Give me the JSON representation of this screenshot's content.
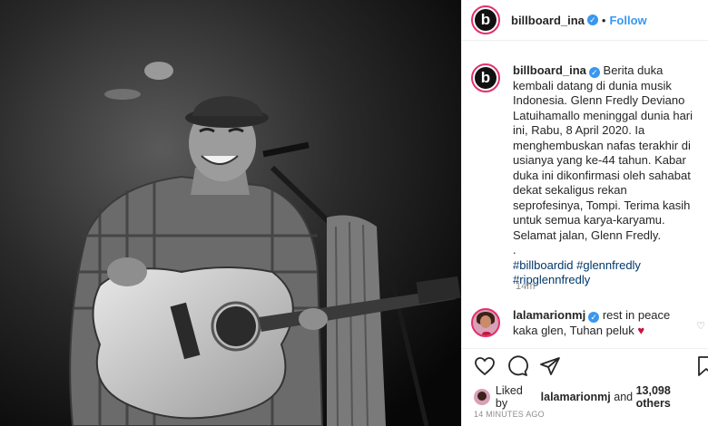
{
  "header": {
    "username": "billboard_ina",
    "avatar_letter": "b",
    "follow_label": "Follow",
    "separator": "•"
  },
  "caption": {
    "username": "billboard_ina",
    "text": "Berita duka kembali datang di dunia musik Indonesia. Glenn Fredly Deviano Latuihamallo meninggal dunia hari ini, Rabu, 8 April 2020. Ia menghembuskan nafas terakhir di usianya yang ke-44 tahun. Kabar duka ini dikonfirmasi oleh sahabat dekat sekaligus rekan seprofesinya, Tompi. Terima kasih untuk semua karya-karyamu. Selamat jalan, Glenn Fredly.",
    "separator_dot": ".",
    "hashtags_line1": "#billboardid #glennfredly",
    "hashtags_line2": "#ripglennfredly",
    "time": "14m"
  },
  "comment": {
    "username": "lalamarionmj",
    "text": "rest in peace kaka glen, Tuhan peluk",
    "emoji": "♥"
  },
  "likes": {
    "prefix": "Liked by",
    "user": "lalamarionmj",
    "middle": "and",
    "count": "13,098 others"
  },
  "timestamp": "14 MINUTES AGO",
  "icons": [
    "heart-icon",
    "comment-icon",
    "share-icon",
    "bookmark-icon",
    "verified-badge-icon"
  ],
  "colors": {
    "link": "#3897f0",
    "hashtag": "#00376b",
    "ring": "#e3306c",
    "muted": "#8e8e8e"
  }
}
